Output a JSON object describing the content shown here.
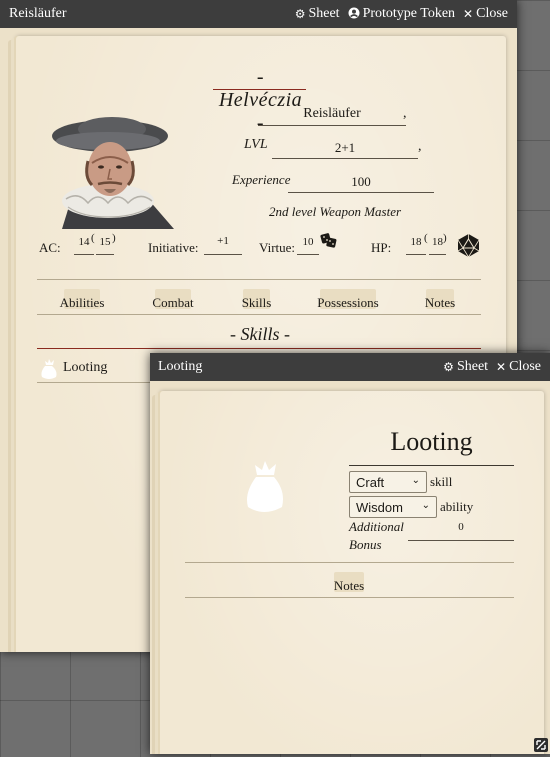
{
  "main_window": {
    "title": "Reisläufer",
    "controls": {
      "sheet": "Sheet",
      "prototype_token": "Prototype Token",
      "close": "Close"
    },
    "character_name": "Helvéczia",
    "class_name": "Reisläufer",
    "lvl_label": "LVL",
    "lvl_value": "2+1",
    "experience_label": "Experience",
    "experience_value": "100",
    "description": "2nd level Weapon Master",
    "ac": {
      "label": "AC:",
      "value": "14",
      "alt": "15"
    },
    "initiative": {
      "label": "Initiative:",
      "value": "+1"
    },
    "virtue": {
      "label": "Virtue:",
      "value": "10"
    },
    "hp": {
      "label": "HP:",
      "value": "18",
      "max": "18"
    },
    "tabs": [
      "Abilities",
      "Combat",
      "Skills",
      "Possessions",
      "Notes"
    ],
    "section_title": "Skills",
    "skill_item": "Looting"
  },
  "item_window": {
    "title": "Looting",
    "controls": {
      "sheet": "Sheet",
      "close": "Close"
    },
    "item_name": "Looting",
    "type_select": "Craft",
    "type_suffix": "skill",
    "ability_select": "Wisdom",
    "ability_suffix": "ability",
    "additional_label": "Additional",
    "bonus_label": "Bonus",
    "bonus_value": "0",
    "notes_tab": "Notes"
  }
}
